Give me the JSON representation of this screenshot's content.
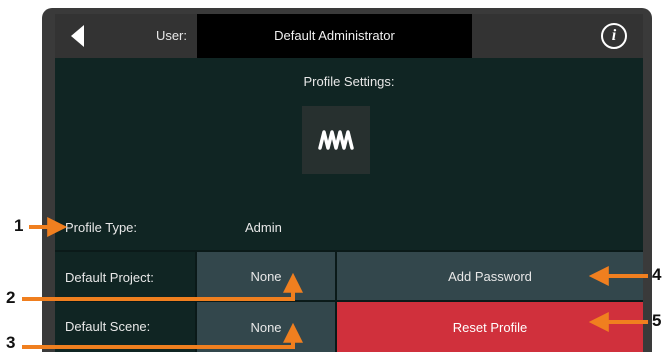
{
  "topbar": {
    "back_icon": "back-arrow-icon",
    "user_label": "User:",
    "user_name": "Default Administrator",
    "info_icon": "info-icon",
    "info_glyph": "i"
  },
  "profile": {
    "section_title": "Profile Settings:",
    "logo_icon": "presonus-logo-icon",
    "profile_type_label": "Profile Type:",
    "profile_type_value": "Admin",
    "default_project_label": "Default Project:",
    "default_project_value": "None",
    "default_scene_label": "Default Scene:",
    "default_scene_value": "None",
    "add_password_label": "Add Password",
    "reset_profile_label": "Reset Profile"
  },
  "callouts": {
    "n1": "1",
    "n2": "2",
    "n3": "3",
    "n4": "4",
    "n5": "5"
  },
  "colors": {
    "screen_bg": "#102523",
    "topbar_bg": "#333333",
    "cell_teal": "#33474c",
    "reset_red": "#d0303c",
    "callout_orange": "#f07f1f"
  }
}
